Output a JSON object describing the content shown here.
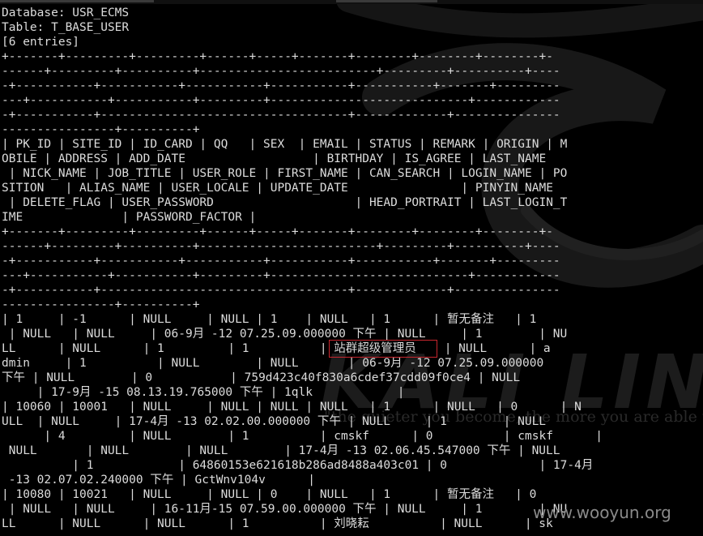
{
  "terminal": {
    "lines": [
      "Database: USR_ECMS",
      "Table: T_BASE_USER",
      "[6 entries]",
      "+-------+---------+---------+------+-----+-------+--------+--------+--------+-",
      "------+---------+----------+-------------------------+---------+----------+----",
      "-+-----------+-----------+-----------+-----------+-----------+-------+---------",
      "---+-----------+-----------+---------+----------------------------+------------",
      "-+-----------+-----------------------------------+-------------+---------------",
      "----------------+----------+",
      "| PK_ID | SITE_ID | ID_CARD | QQ   | SEX  | EMAIL | STATUS | REMARK | ORIGIN | M",
      "OBILE | ADDRESS | ADD_DATE                  | BIRTHDAY | IS_AGREE | LAST_NAME",
      " | NICK_NAME | JOB_TITLE | USER_ROLE | FIRST_NAME | CAN_SEARCH | LOGIN_NAME | PO",
      "SITION   | ALIAS_NAME | USER_LOCALE | UPDATE_DATE                | PINYIN_NAME",
      " | DELETE_FLAG | USER_PASSWORD                    | HEAD_PORTRAIT | LAST_LOGIN_T",
      "IME              | PASSWORD_FACTOR |",
      "+-------+---------+---------+------+-----+-------+--------+--------+--------+-",
      "------+---------+----------+-------------------------+---------+----------+----",
      "-+-----------+-----------+-----------+-----------+-----------+-------+---------",
      "---+-----------+-----------+---------+----------------------------+------------",
      "-+-----------+-----------------------------------+-------------+---------------",
      "----------------+----------+",
      "| 1     | -1      | NULL     | NULL | 1    | NULL   | 1      | 暂无备注   | 1",
      " | NULL   | NULL     | 06-9月 -12 07.25.09.000000 下午 | NULL     | 1        | NU",
      "LL      | NULL      | 1         | 1          | 站群超级管理员    | NULL      | a",
      "dmin     | 1          | NULL        | NULL       | 06-9月 -12 07.25.09.000000",
      "下午 | NULL        | 0           | 759d423c40f830a6cdef37cdd09f0ce4 | NULL",
      "     | 17-9月 -15 08.13.19.765000 下午 | 1qlk            |",
      "| 10060 | 10001   | NULL     | NULL | NULL | NULL   | 1      | NULL   | 0      | N",
      "ULL  | NULL     | 17-4月 -13 02.02.00.000000 下午 | NULL     | 1        | NULL",
      "      | 4         | NULL        | 1          | cmskf      | 0          | cmskf      |",
      " NULL       | NULL        | NULL        | 17-4月 -13 02.06.45.547000 下午 | NULL",
      "          | 1            | 64860153e621618b286ad8488a403c01 | 0             | 17-4月",
      " -13 02.07.02.240000 下午 | GctWnv104v      |",
      "| 10080 | 10021   | NULL     | NULL | 0    | NULL   | 1      | 暂无备注   | 0",
      " | NULL   | NULL     | 16-11月-15 07.59.00.000000 下午 | NULL     | 1        | NU",
      "LL      | NULL      | NULL      | 1          | 刘晓耘          | NULL      | sk"
    ]
  },
  "background": {
    "logo_text": "KALI LINUX",
    "tagline": "\"the quieter you become, the more you are able to hear\""
  },
  "watermark": {
    "text": "www.wooyun.org"
  },
  "colors": {
    "background": "#000000",
    "text": "#dcdcdc",
    "highlight_border": "#c8262e",
    "watermark": "#8a8a8a"
  }
}
